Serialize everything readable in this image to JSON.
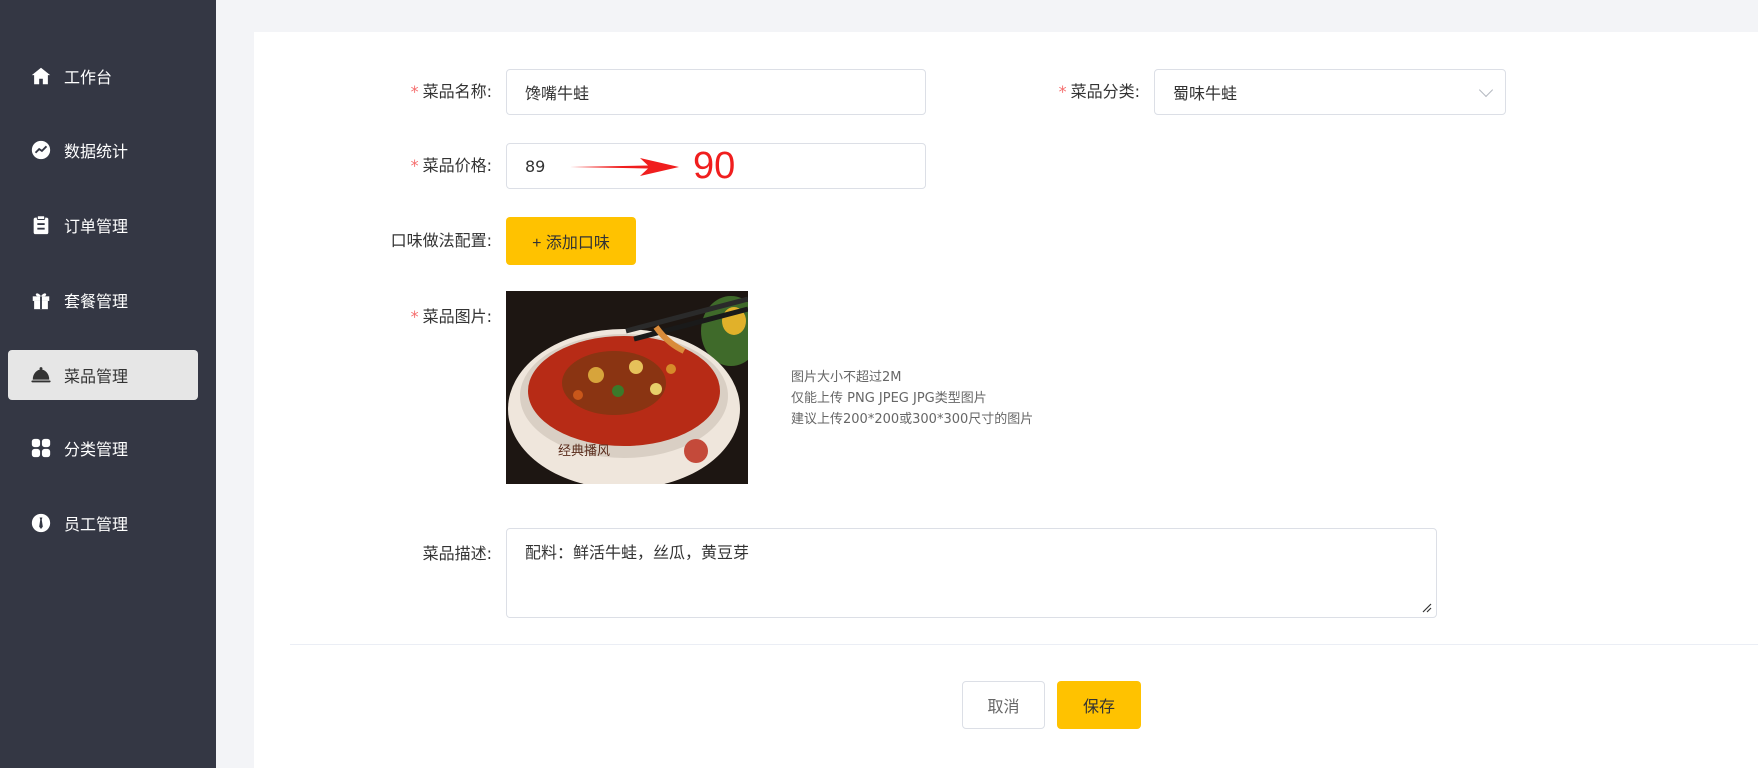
{
  "sidebar": {
    "items": [
      {
        "label": "工作台",
        "icon": "home-icon"
      },
      {
        "label": "数据统计",
        "icon": "chart-icon"
      },
      {
        "label": "订单管理",
        "icon": "clipboard-icon"
      },
      {
        "label": "套餐管理",
        "icon": "gift-icon"
      },
      {
        "label": "菜品管理",
        "icon": "cloche-icon",
        "active": true
      },
      {
        "label": "分类管理",
        "icon": "grid-icon"
      },
      {
        "label": "员工管理",
        "icon": "tie-icon"
      }
    ]
  },
  "form": {
    "name_label": "菜品名称:",
    "name_value": "馋嘴牛蛙",
    "category_label": "菜品分类:",
    "category_value": "蜀味牛蛙",
    "price_label": "菜品价格:",
    "price_value": "89",
    "flavor_label": "口味做法配置:",
    "add_flavor_button": "+ 添加口味",
    "image_label": "菜品图片:",
    "image_hints": [
      "图片大小不超过2M",
      "仅能上传 PNG JPEG JPG类型图片",
      "建议上传200*200或300*300尺寸的图片"
    ],
    "desc_label": "菜品描述:",
    "desc_value": "配料：鲜活牛蛙，丝瓜，黄豆芽",
    "required_mark": "*"
  },
  "actions": {
    "cancel_label": "取消",
    "save_label": "保存"
  },
  "annotation": {
    "new_price": "90",
    "color": "#f01e1e"
  },
  "colors": {
    "sidebar_bg": "#343744",
    "accent": "#ffc200",
    "required": "#f56c6c"
  }
}
